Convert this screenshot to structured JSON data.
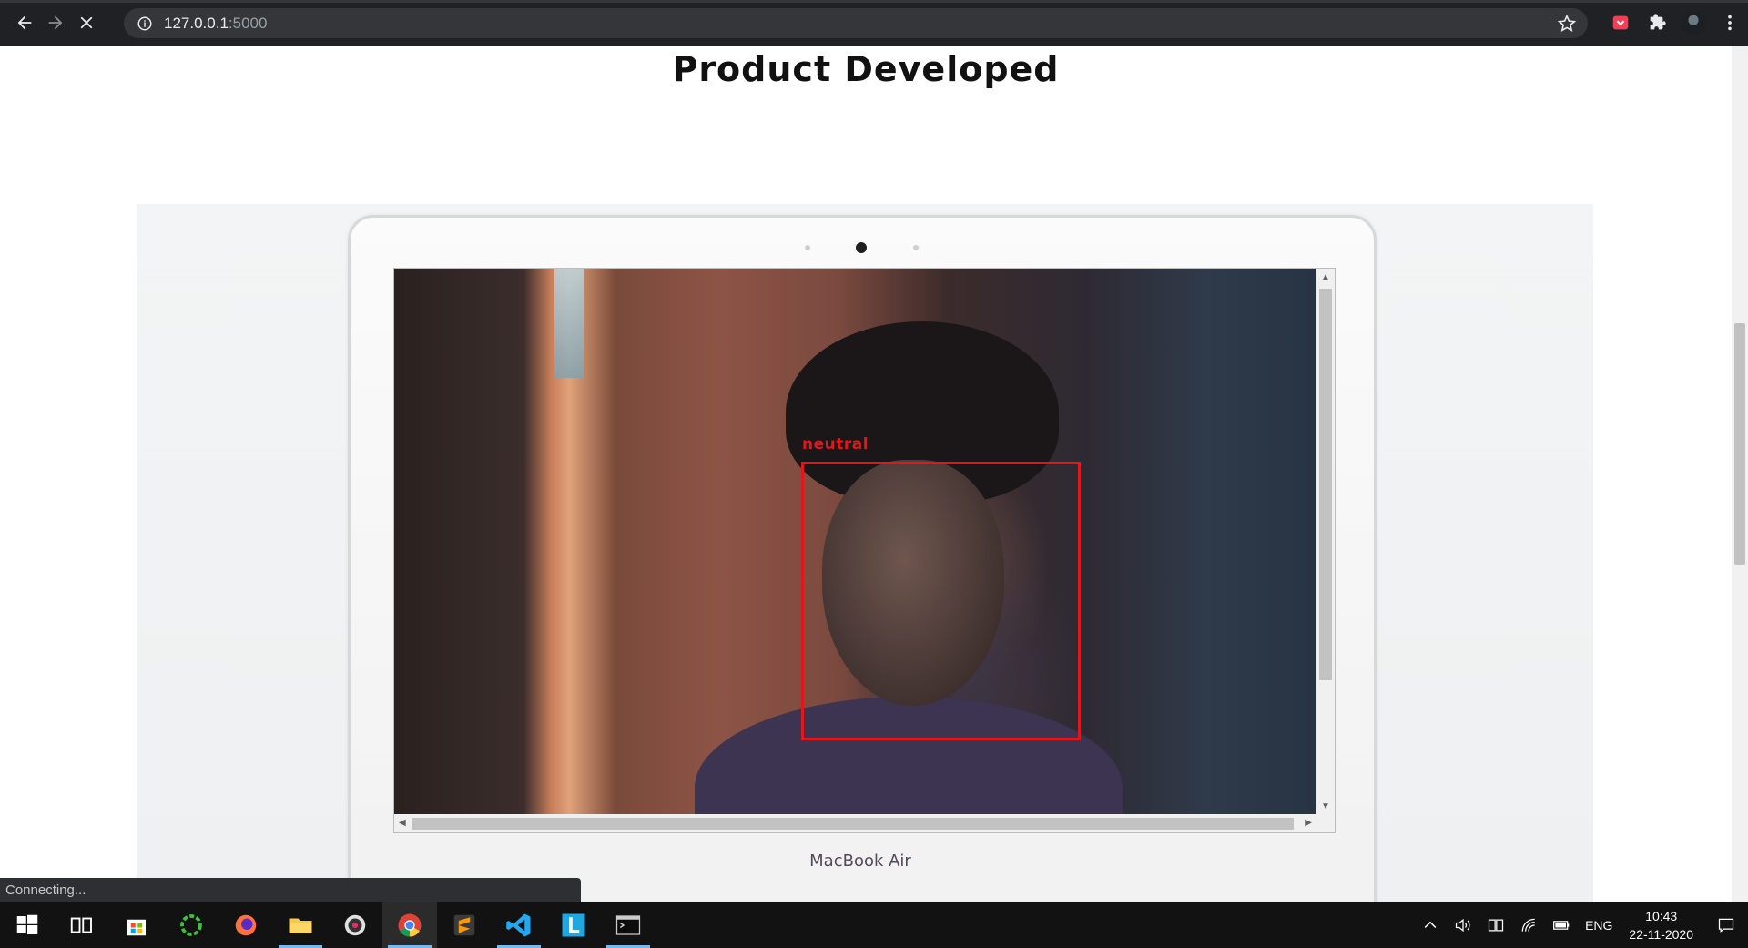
{
  "browser": {
    "url_host": "127.0.0.1",
    "url_port": ":5000",
    "status_text": "Connecting..."
  },
  "page": {
    "title": "Product Developed",
    "device_brand": "MacBook Air"
  },
  "video": {
    "detection_label": "neutral",
    "box_color": "#e5161b"
  },
  "taskbar": {
    "apps": [
      "start",
      "task-view",
      "store",
      "app-green-ring",
      "firefox",
      "file-explorer",
      "media-player",
      "chrome",
      "sublime-text",
      "vs-code",
      "app-l",
      "terminal"
    ],
    "language": "ENG",
    "time": "10:43",
    "date": "22-11-2020"
  }
}
